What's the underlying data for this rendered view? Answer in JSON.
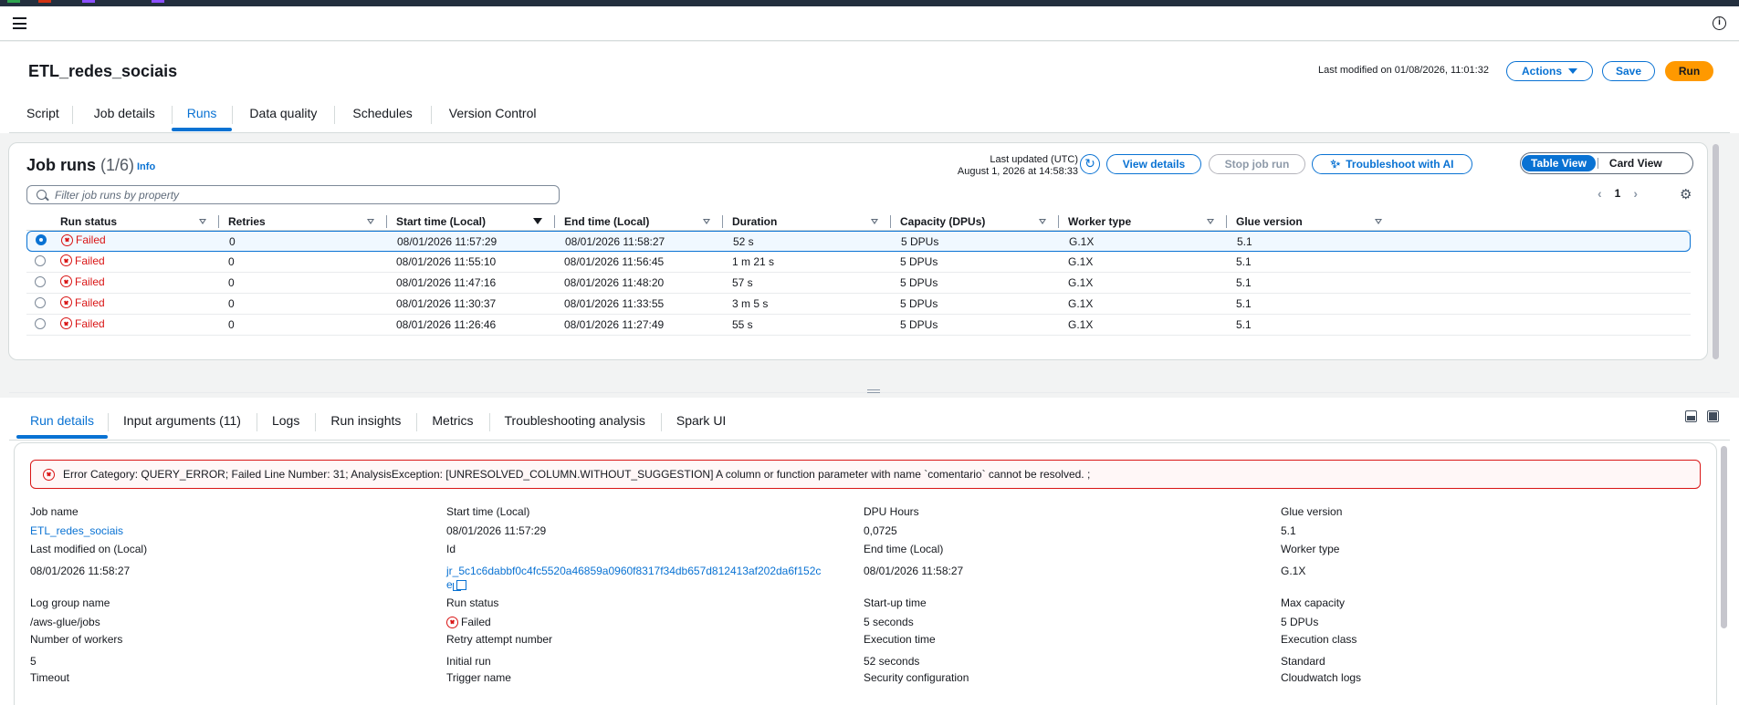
{
  "topbar": {
    "info_icon": "i"
  },
  "job": {
    "title": "ETL_redes_sociais",
    "last_modified": "Last modified on 01/08/2026, 11:01:32",
    "actions_label": "Actions",
    "save_label": "Save",
    "run_label": "Run"
  },
  "main_tabs": [
    "Script",
    "Job details",
    "Runs",
    "Data quality",
    "Schedules",
    "Version Control"
  ],
  "runs": {
    "title": "Job runs",
    "count": "(1/6)",
    "info_label": "Info",
    "last_updated_label": "Last updated (UTC)",
    "last_updated_value": "August 1, 2026 at 14:58:33",
    "view_details_label": "View details",
    "stop_job_run_label": "Stop job run",
    "troubleshoot_label": "Troubleshoot with AI",
    "table_view_label": "Table View",
    "card_view_label": "Card View",
    "search_placeholder": "Filter job runs by property",
    "page": "1",
    "columns": [
      "Run status",
      "Retries",
      "Start time (Local)",
      "End time (Local)",
      "Duration",
      "Capacity (DPUs)",
      "Worker type",
      "Glue version"
    ],
    "rows": [
      {
        "status": "Failed",
        "retries": "0",
        "start": "08/01/2026 11:57:29",
        "end": "08/01/2026 11:58:27",
        "duration": "52 s",
        "capacity": "5 DPUs",
        "worker": "G.1X",
        "glue": "5.1"
      },
      {
        "status": "Failed",
        "retries": "0",
        "start": "08/01/2026 11:55:10",
        "end": "08/01/2026 11:56:45",
        "duration": "1 m 21 s",
        "capacity": "5 DPUs",
        "worker": "G.1X",
        "glue": "5.1"
      },
      {
        "status": "Failed",
        "retries": "0",
        "start": "08/01/2026 11:47:16",
        "end": "08/01/2026 11:48:20",
        "duration": "57 s",
        "capacity": "5 DPUs",
        "worker": "G.1X",
        "glue": "5.1"
      },
      {
        "status": "Failed",
        "retries": "0",
        "start": "08/01/2026 11:30:37",
        "end": "08/01/2026 11:33:55",
        "duration": "3 m 5 s",
        "capacity": "5 DPUs",
        "worker": "G.1X",
        "glue": "5.1"
      },
      {
        "status": "Failed",
        "retries": "0",
        "start": "08/01/2026 11:26:46",
        "end": "08/01/2026 11:27:49",
        "duration": "55 s",
        "capacity": "5 DPUs",
        "worker": "G.1X",
        "glue": "5.1"
      }
    ]
  },
  "detail_tabs": [
    "Run details",
    "Input arguments (11)",
    "Logs",
    "Run insights",
    "Metrics",
    "Troubleshooting analysis",
    "Spark UI"
  ],
  "details": {
    "error": "Error Category: QUERY_ERROR; Failed Line Number: 31; AnalysisException: [UNRESOLVED_COLUMN.WITHOUT_SUGGESTION] A column or function parameter with name `comentario` cannot be resolved. ;",
    "job_name_k": "Job name",
    "job_name_v": "ETL_redes_sociais",
    "start_k": "Start time (Local)",
    "start_v": "08/01/2026 11:57:29",
    "dpu_k": "DPU Hours",
    "dpu_v": "0,0725",
    "glue_k": "Glue version",
    "glue_v": "5.1",
    "lastmod_k": "Last modified on (Local)",
    "lastmod_v": "08/01/2026 11:58:27",
    "id_k": "Id",
    "id_v1": "jr_5c1c6dabbf0c4fc5520a46859a0960f8317f34db657d812413af202da6f152c",
    "id_v2": "e",
    "end_k": "End time (Local)",
    "end_v": "08/01/2026 11:58:27",
    "worker_k": "Worker type",
    "worker_v": "G.1X",
    "loggroup_k": "Log group name",
    "loggroup_v": "/aws-glue/jobs",
    "runstatus_k": "Run status",
    "runstatus_v": "Failed",
    "startup_k": "Start-up time",
    "startup_v": "5 seconds",
    "maxcap_k": "Max capacity",
    "maxcap_v": "5 DPUs",
    "workers_k": "Number of workers",
    "workers_v": "5",
    "retry_k": "Retry attempt number",
    "retry_v": "Initial run",
    "exec_k": "Execution time",
    "exec_v": "52 seconds",
    "execclass_k": "Execution class",
    "execclass_v": "Standard",
    "timeout_k": "Timeout",
    "trigger_k": "Trigger name",
    "security_k": "Security configuration",
    "cloudwatch_k": "Cloudwatch logs"
  }
}
